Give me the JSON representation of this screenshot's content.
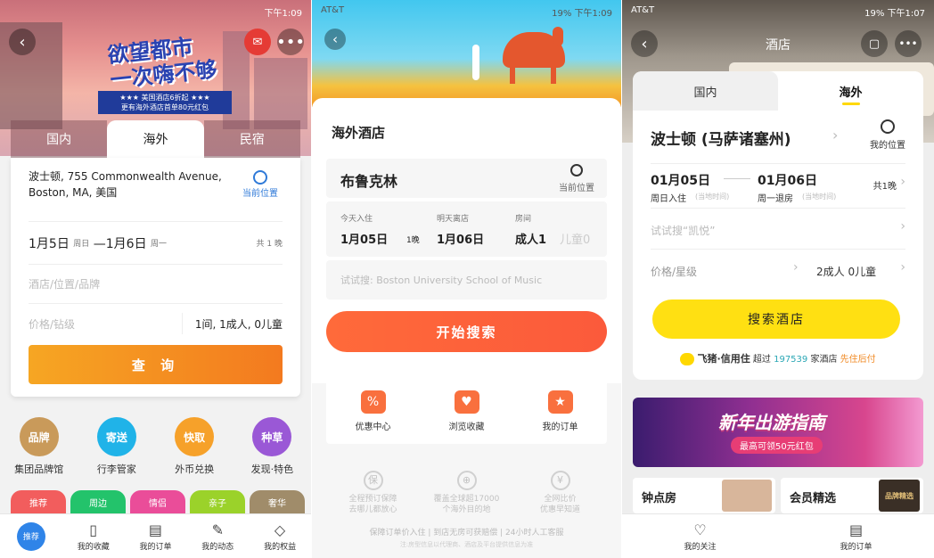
{
  "phone1": {
    "status": {
      "left": "",
      "right": "下午1:09"
    },
    "banner": {
      "title_line1": "欲望都市",
      "title_line2": "一次嗨不够",
      "sub_line1": "★★★ 美国酒店6折起 ★★★",
      "sub_line2": "更有海外酒店首单80元红包"
    },
    "tabs": [
      "国内",
      "海外",
      "民宿"
    ],
    "address": "波士顿, 755 Commonwealth Avenue, Boston, MA, 美国",
    "location_label": "当前位置",
    "checkin": "1月5日",
    "checkin_day": "周日",
    "checkout": "—1月6日",
    "checkout_day": "周一",
    "nights": "共 1 晚",
    "keyword_placeholder": "酒店/位置/品牌",
    "price_placeholder": "价格/钻级",
    "rooms_guests": "1间, 1成人, 0儿童",
    "search_button": "查 询",
    "icons": [
      {
        "label": "集团品牌馆",
        "badge": "品牌",
        "color": "#c99a5a"
      },
      {
        "label": "行李管家",
        "badge": "寄送",
        "color": "#20b3e8"
      },
      {
        "label": "外币兑换",
        "badge": "快取",
        "color": "#f6a12a"
      },
      {
        "label": "发现·特色",
        "badge": "种草",
        "color": "#9a58d6"
      }
    ],
    "pills": [
      {
        "label": "推荐",
        "color": "#f25d5d"
      },
      {
        "label": "周边",
        "color": "#23c36b"
      },
      {
        "label": "情侣",
        "color": "#ea4d99"
      },
      {
        "label": "亲子",
        "color": "#9bd22a"
      },
      {
        "label": "奢华",
        "color": "#a08c6a"
      }
    ],
    "nav": [
      "推荐",
      "我的收藏",
      "我的订单",
      "我的动态",
      "我的权益"
    ]
  },
  "phone2": {
    "status": {
      "left": "AT&T",
      "right": "19%  下午1:09"
    },
    "title": "海外酒店",
    "city": "布鲁克林",
    "location_label": "当前位置",
    "checkin_caption": "今天入住",
    "checkin": "1月05日",
    "nights": "1晚",
    "checkout_caption": "明天离店",
    "checkout": "1月06日",
    "room_caption": "房间",
    "adults": "成人1",
    "children": "儿童0",
    "search_placeholder": "试试搜: Boston University School of Music",
    "search_button": "开始搜索",
    "quick": [
      "优惠中心",
      "浏览收藏",
      "我的订单"
    ],
    "guarantees": [
      {
        "line1": "全程预订保障",
        "line2": "去哪儿都放心"
      },
      {
        "line1": "覆盖全球超17000",
        "line2": "个海外目的地"
      },
      {
        "line1": "全网比价",
        "line2": "优惠早知道"
      }
    ],
    "footer1": "保障订单价入住 | 到店无房可获赔偿 | 24小时人工客服",
    "footer2": "注:房型信息以代理商、酒店及平台提供信息为准"
  },
  "phone3": {
    "status": {
      "left": "AT&T",
      "right": "19%  下午1:07"
    },
    "header_title": "酒店",
    "tabs": [
      "国内",
      "海外"
    ],
    "city": "波士顿 (马萨诸塞州)",
    "location_label": "我的位置",
    "checkin": "01月05日",
    "checkin_caption": "周日入住",
    "checkin_note": "(当地时间)",
    "checkout": "01月06日",
    "checkout_caption": "周一退房",
    "checkout_note": "(当地时间)",
    "nights": "共1晚",
    "keyword_placeholder": "试试搜“凯悦”",
    "price_label": "价格/星级",
    "guests": "2成人  0儿童",
    "search_button": "搜索酒店",
    "credit_brand": "飞猪·信用住",
    "credit_text_pre": "超过",
    "credit_count": "197539",
    "credit_text_mid": "家酒店",
    "credit_text_post": "先住后付",
    "promo_title": "新年出游指南",
    "promo_sub": "最高可领50元红包",
    "card1": "钟点房",
    "card2": "会员精选",
    "card2_badge": "品牌精选",
    "nav": [
      "我的关注",
      "我的订单"
    ]
  }
}
